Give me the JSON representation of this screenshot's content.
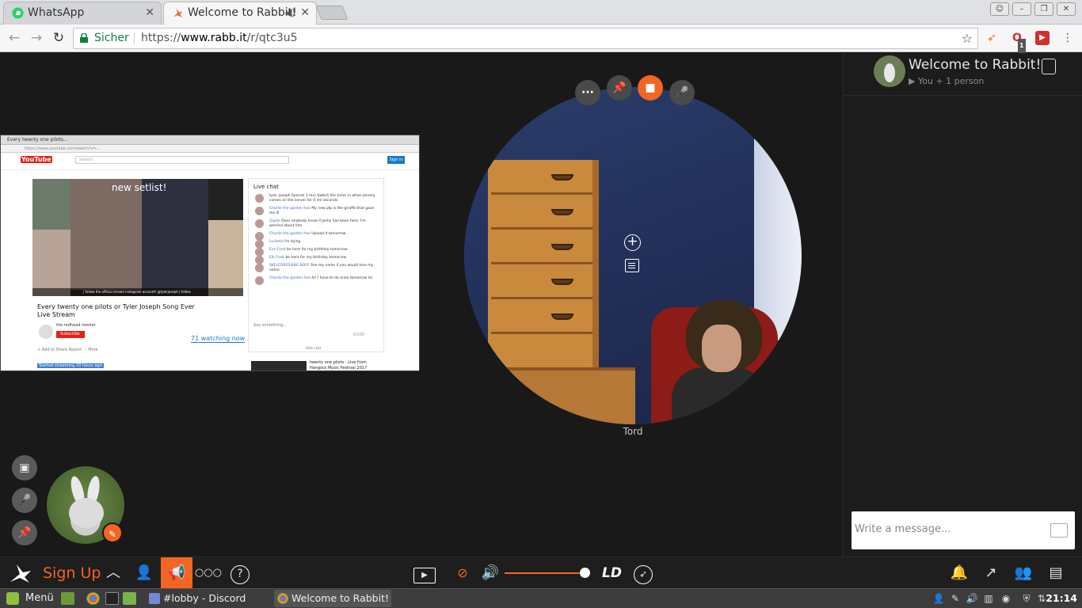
{
  "browser": {
    "tabs": [
      {
        "title": "WhatsApp",
        "favicon": "whatsapp-icon"
      },
      {
        "title": "Welcome to Rabbit!",
        "favicon": "rabbit-icon",
        "audio": true
      }
    ],
    "secure_label": "Sicher",
    "url_prefix": "https://",
    "url_host": "www.rabb.it",
    "url_path": "/r/qtc3u5",
    "window_controls": [
      "profile",
      "minimize",
      "restore",
      "close"
    ],
    "extension_badge": "1"
  },
  "shared_screen": {
    "browser_tab": "Every twenty one pilots...",
    "address": "https://www.youtube.com/watch?v=...",
    "site_logo": "YouTube",
    "search_placeholder": "Search",
    "signin_label": "Sign in",
    "video_title_overlay": "new setlist!",
    "video_bottom_overlay": "| follow the official stream instagram account! @tylerjoseph | follow",
    "video_title": "Every twenty one pilots or Tyler Joseph Song Ever Live Stream",
    "channel": "the redhead rooster",
    "subscribe_label": "Subscribe",
    "watching": "71 watching now",
    "actions": "+ Add to    Share    Report    ··· More",
    "description": "Started streaming 20 hours ago",
    "chat": {
      "header": "Live chat",
      "messages": [
        {
          "name": "",
          "text": "tyler joseph fan(not 1 mo) Switch the timer in when jeremy comes on the server for 0 mil seconds"
        },
        {
          "name": "Charlie the garden hoe",
          "text": "My new pfp is the giraffe that gave me ill"
        },
        {
          "name": "Zaylie",
          "text": "Does anybody know if Joshy has been here. I'm worried about him"
        },
        {
          "name": "Charlie the garden hoe",
          "text": "Upload it tomorrow"
        },
        {
          "name": "Luckela",
          "text": "I'm dying"
        },
        {
          "name": "Evo Frost",
          "text": "be here for my birthday tomorrow"
        },
        {
          "name": "Elk Frost",
          "text": "be here for my birthday tomorrow"
        },
        {
          "name": "SKELEDRESSING BOO!",
          "text": "See my name if you would love my name"
        },
        {
          "name": "Charlie the garden hoe",
          "text": "Ari I have to do mine tomorrow lol"
        }
      ],
      "input_placeholder": "Say something...",
      "char_count": "0/200",
      "hide_label": "Hide chat"
    },
    "related_title": "twenty one pilots - Live from Hangout Music Festival 2017"
  },
  "remote_cam": {
    "name": "Tord",
    "controls": [
      "more-icon",
      "pin-icon",
      "camera-icon",
      "mic-muted-icon"
    ]
  },
  "room": {
    "title": "Welcome to Rabbit!",
    "subtitle": "▶ You + 1 person",
    "message_placeholder": "Write a message..."
  },
  "bottom_bar": {
    "signup_label": "Sign Up",
    "quality_label": "LD",
    "volume_level": 0.95,
    "accent_color": "#f26522"
  },
  "taskbar": {
    "menu_label": "Menü",
    "tasks": [
      {
        "title": "#lobby - Discord",
        "icon": "discord-icon"
      },
      {
        "title": "Welcome to Rabbit! ...",
        "icon": "chrome-icon"
      }
    ],
    "clock": "21:14"
  }
}
